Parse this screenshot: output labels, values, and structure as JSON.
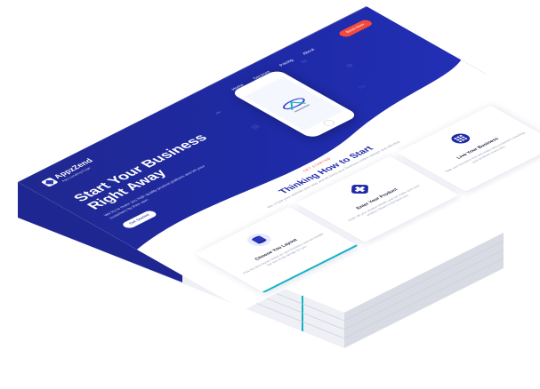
{
  "nav": {
    "logo_text": "AppzZend",
    "logo_sub": "App Landing Page",
    "menu": [
      "Home",
      "Services",
      "Pricing",
      "About"
    ],
    "cta": "Book Now"
  },
  "hero": {
    "title": "Start Your Business Right Away",
    "text": "We try to make you high quality product platform and let your customers fly their own.",
    "button": "Get Started"
  },
  "section": {
    "eyebrow": "GET STARTED",
    "title": "Thinking How to Start",
    "subtitle": "We create your website your way and we keep your business online always and effective"
  },
  "cards": [
    {
      "title": "Choose You Layout",
      "text": "Pick the best layout suited for your business and we handle the rest of the design for you.",
      "icon": "database-icon"
    },
    {
      "title": "Enter Your Product",
      "text": "Enter all your product details and we make sure your product shines in the best way.",
      "icon": "plus-badge-icon"
    },
    {
      "title": "Live Your Business",
      "text": "Take your business live and enjoy new customers reaching your products every day.",
      "icon": "globe-icon"
    }
  ],
  "colors": {
    "primary": "#1e2aa6",
    "accent": "#f34a3c",
    "teal": "#14b3c4"
  }
}
